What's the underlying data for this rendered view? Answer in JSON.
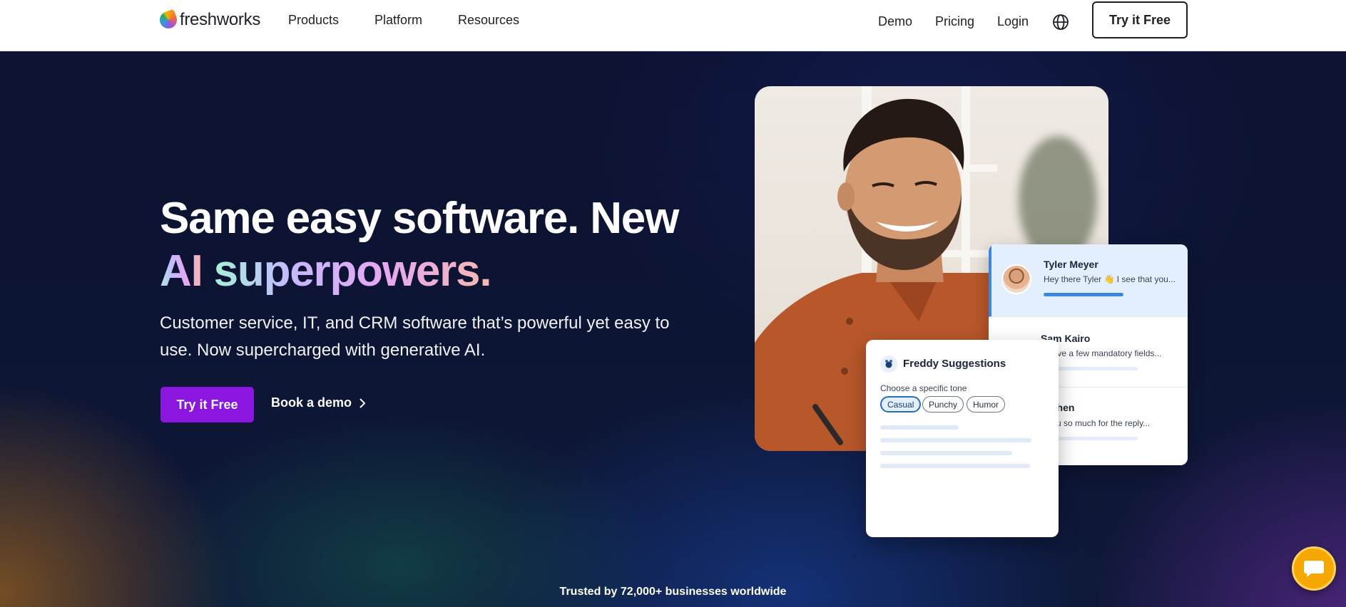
{
  "header": {
    "logo_text": "freshworks",
    "nav": {
      "products": "Products",
      "platform": "Platform",
      "resources": "Resources",
      "demo": "Demo",
      "pricing": "Pricing",
      "login": "Login"
    },
    "cta": "Try it Free",
    "language_icon": "globe-icon"
  },
  "hero": {
    "headline_line1": "Same easy software. New",
    "headline_line2_part1": "AI",
    "headline_line2_part2": "superpowers.",
    "subtext": "Customer service, IT, and CRM software that’s powerful yet easy to use. Now supercharged with generative AI.",
    "primary_cta": "Try it Free",
    "secondary_cta": "Book a demo",
    "trusted": "Trusted by 72,000+ businesses worldwide"
  },
  "conversations": [
    {
      "name": "Tyler Meyer",
      "message": "Hey there Tyler 👋 I see that you...",
      "active": true
    },
    {
      "name": "Sam Kairo",
      "message": "e have a few mandatory fields..."
    },
    {
      "name": "n Chen",
      "message": "k you so much for the reply..."
    }
  ],
  "freddy": {
    "title": "Freddy Suggestions",
    "tone_label": "Choose a specific tone",
    "tones": [
      "Casual",
      "Punchy",
      "Humor"
    ],
    "selected_tone": "Casual"
  },
  "colors": {
    "primary_purple": "#8a16e0",
    "header_bg": "#ffffff",
    "chat_button": "#f6a800",
    "selected_blue": "#2c6cc0"
  },
  "chat_widget": {
    "icon": "chat-icon"
  }
}
